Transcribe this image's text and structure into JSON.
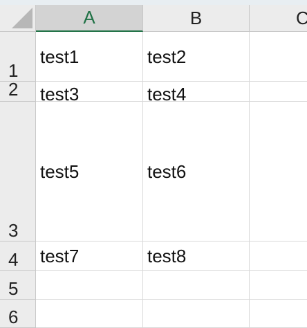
{
  "columns": [
    {
      "label": "A"
    },
    {
      "label": "B"
    },
    {
      "label": "C"
    }
  ],
  "rows": [
    {
      "label": "1",
      "cells": [
        "test1",
        "test2",
        ""
      ]
    },
    {
      "label": "2",
      "cells": [
        "test3",
        "test4",
        ""
      ]
    },
    {
      "label": "3",
      "cells": [
        "test5",
        "test6",
        ""
      ]
    },
    {
      "label": "4",
      "cells": [
        "test7",
        "test8",
        ""
      ]
    },
    {
      "label": "5",
      "cells": [
        "",
        "",
        ""
      ]
    },
    {
      "label": "6",
      "cells": [
        "",
        "",
        ""
      ]
    }
  ],
  "selected_column": "A",
  "colors": {
    "selected_header_text": "#1f7145",
    "header_bg": "#ececec",
    "selected_header_bg": "#d3d3d3",
    "gridline": "#d9d9d9"
  }
}
